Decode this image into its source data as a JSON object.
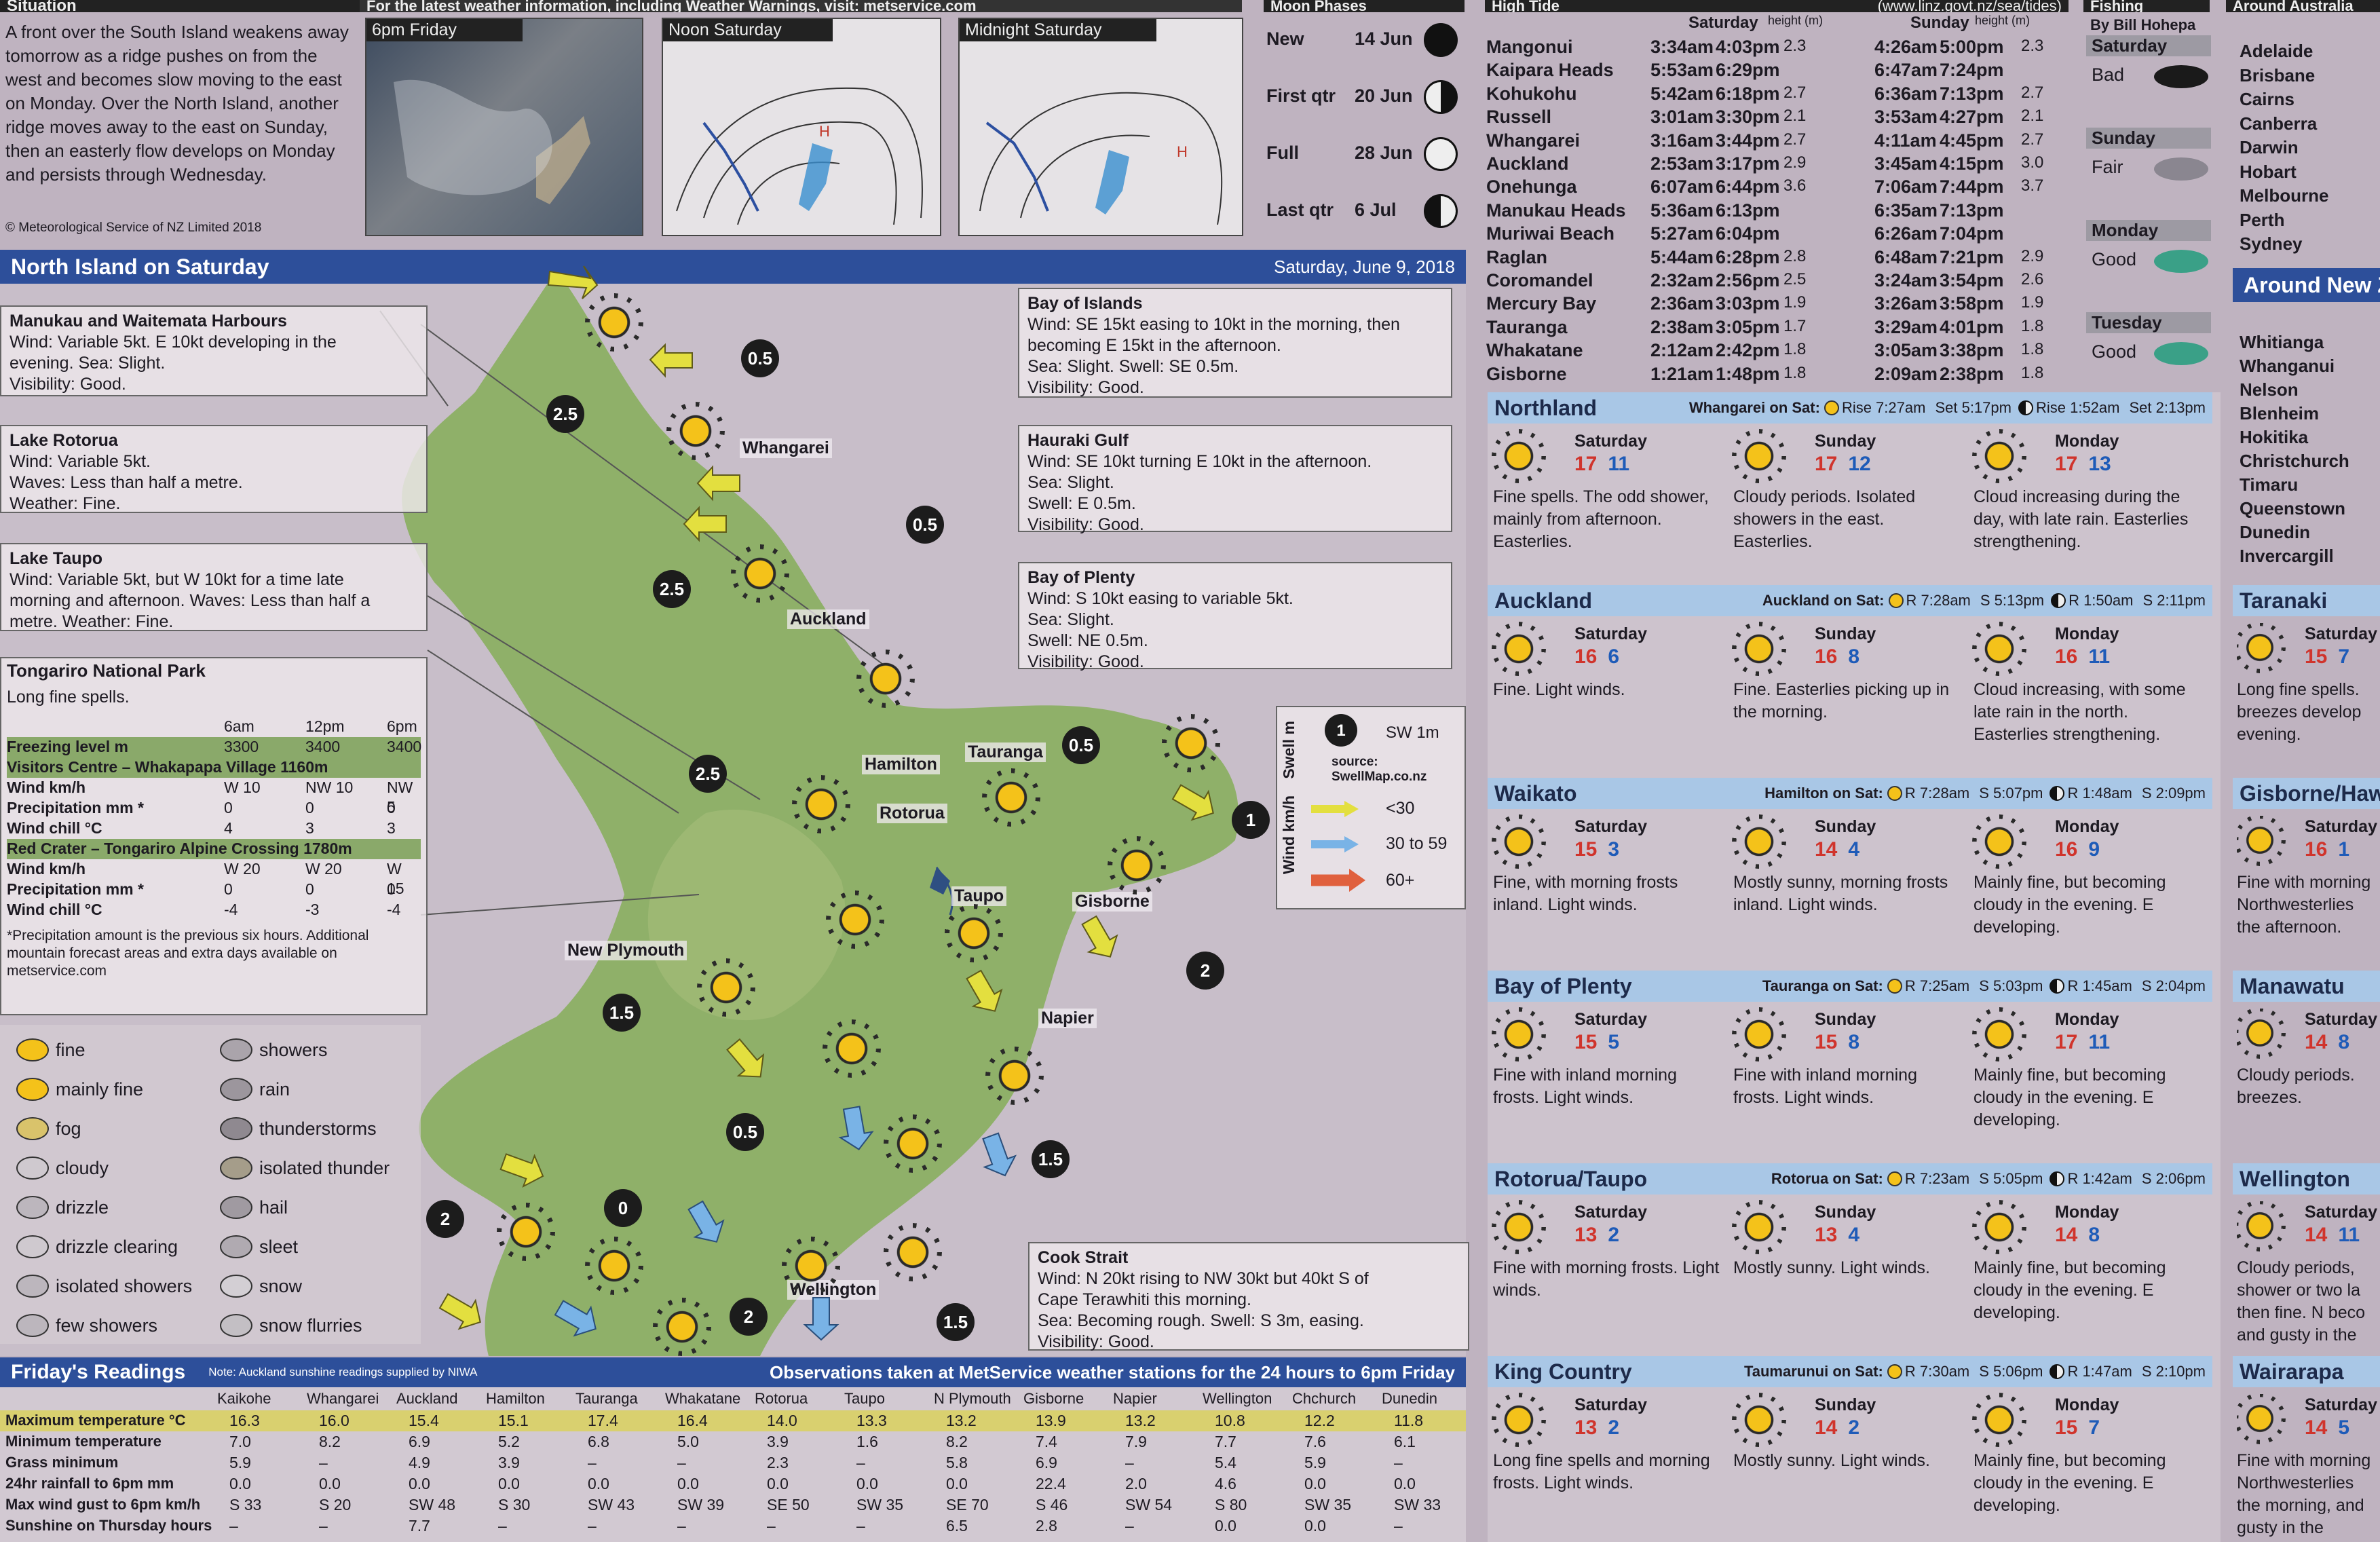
{
  "situation": {
    "title": "Situation",
    "text": "A front over the South Island weakens away tomorrow as a ridge pushes on from the west and becomes slow moving to the east on Monday. Over the North Island, another ridge moves away to the east on Sunday, then an easterly flow develops on Monday and persists through Wednesday.",
    "copyright": "© Meteorological Service of NZ Limited 2018",
    "map_titles": [
      "6pm Friday",
      "Noon Saturday",
      "Midnight Saturday"
    ],
    "top_note": "For the latest weather information, including Weather Warnings, visit: metservice.com"
  },
  "moon": {
    "title": "Moon Phases",
    "phases": [
      {
        "name": "New",
        "date": "14 Jun"
      },
      {
        "name": "First qtr",
        "date": "20 Jun"
      },
      {
        "name": "Full",
        "date": "28 Jun"
      },
      {
        "name": "Last qtr",
        "date": "6 Jul"
      }
    ]
  },
  "tides": {
    "title": "High Tide",
    "source": "(www.linz.govt.nz/sea/tides)",
    "col_sat": "Saturday",
    "col_sun": "Sunday",
    "height_label": "height (m)",
    "rows": [
      {
        "place": "Mangonui",
        "s1": "3:34am",
        "s2": "4:03pm",
        "sh": "2.3",
        "u1": "4:26am",
        "u2": "5:00pm",
        "uh": "2.3"
      },
      {
        "place": "Kaipara Heads",
        "s1": "5:53am",
        "s2": "6:29pm",
        "sh": "",
        "u1": "6:47am",
        "u2": "7:24pm",
        "uh": ""
      },
      {
        "place": "Kohukohu",
        "s1": "5:42am",
        "s2": "6:18pm",
        "sh": "2.7",
        "u1": "6:36am",
        "u2": "7:13pm",
        "uh": "2.7"
      },
      {
        "place": "Russell",
        "s1": "3:01am",
        "s2": "3:30pm",
        "sh": "2.1",
        "u1": "3:53am",
        "u2": "4:27pm",
        "uh": "2.1"
      },
      {
        "place": "Whangarei",
        "s1": "3:16am",
        "s2": "3:44pm",
        "sh": "2.7",
        "u1": "4:11am",
        "u2": "4:45pm",
        "uh": "2.7"
      },
      {
        "place": "Auckland",
        "s1": "2:53am",
        "s2": "3:17pm",
        "sh": "2.9",
        "u1": "3:45am",
        "u2": "4:15pm",
        "uh": "3.0"
      },
      {
        "place": "Onehunga",
        "s1": "6:07am",
        "s2": "6:44pm",
        "sh": "3.6",
        "u1": "7:06am",
        "u2": "7:44pm",
        "uh": "3.7"
      },
      {
        "place": "Manukau Heads",
        "s1": "5:36am",
        "s2": "6:13pm",
        "sh": "",
        "u1": "6:35am",
        "u2": "7:13pm",
        "uh": ""
      },
      {
        "place": "Muriwai Beach",
        "s1": "5:27am",
        "s2": "6:04pm",
        "sh": "",
        "u1": "6:26am",
        "u2": "7:04pm",
        "uh": ""
      },
      {
        "place": "Raglan",
        "s1": "5:44am",
        "s2": "6:28pm",
        "sh": "2.8",
        "u1": "6:48am",
        "u2": "7:21pm",
        "uh": "2.9"
      },
      {
        "place": "Coromandel",
        "s1": "2:32am",
        "s2": "2:56pm",
        "sh": "2.5",
        "u1": "3:24am",
        "u2": "3:54pm",
        "uh": "2.6"
      },
      {
        "place": "Mercury Bay",
        "s1": "2:36am",
        "s2": "3:03pm",
        "sh": "1.9",
        "u1": "3:26am",
        "u2": "3:58pm",
        "uh": "1.9"
      },
      {
        "place": "Tauranga",
        "s1": "2:38am",
        "s2": "3:05pm",
        "sh": "1.7",
        "u1": "3:29am",
        "u2": "4:01pm",
        "uh": "1.8"
      },
      {
        "place": "Whakatane",
        "s1": "2:12am",
        "s2": "2:42pm",
        "sh": "1.8",
        "u1": "3:05am",
        "u2": "3:38pm",
        "uh": "1.8"
      },
      {
        "place": "Gisborne",
        "s1": "1:21am",
        "s2": "1:48pm",
        "sh": "1.8",
        "u1": "2:09am",
        "u2": "2:38pm",
        "uh": "1.8"
      }
    ]
  },
  "fishing": {
    "title": "Fishing",
    "author": "By Bill Hohepa",
    "days": [
      {
        "day": "Saturday",
        "rating": "Bad"
      },
      {
        "day": "Sunday",
        "rating": "Fair"
      },
      {
        "day": "Monday",
        "rating": "Good"
      },
      {
        "day": "Tuesday",
        "rating": "Good"
      }
    ]
  },
  "australia": {
    "title": "Around Australia",
    "cities": [
      "Adelaide",
      "Brisbane",
      "Cairns",
      "Canberra",
      "Darwin",
      "Hobart",
      "Melbourne",
      "Perth",
      "Sydney"
    ]
  },
  "around_nz": {
    "title": "Around New Zealand",
    "cities": [
      "Whitianga",
      "Whanganui",
      "Nelson",
      "Blenheim",
      "Hokitika",
      "Christchurch",
      "Timaru",
      "Queenstown",
      "Dunedin",
      "Invercargill"
    ]
  },
  "north_island": {
    "title": "North Island on Saturday",
    "date": "Saturday, June 9, 2018",
    "marine": [
      {
        "title": "Manukau and Waitemata Harbours",
        "lines": [
          "Wind: Variable 5kt. E 10kt developing in the",
          "evening. Sea: Slight.",
          "Visibility: Good."
        ]
      },
      {
        "title": "Lake Rotorua",
        "lines": [
          "Wind: Variable 5kt.",
          "Waves: Less than half a metre.",
          "Weather: Fine."
        ]
      },
      {
        "title": "Lake Taupo",
        "lines": [
          "Wind: Variable 5kt, but W 10kt for a time late",
          "morning and afternoon. Waves: Less than half a",
          "metre. Weather: Fine."
        ]
      },
      {
        "title": "Bay of Islands",
        "lines": [
          "Wind: SE 15kt easing to 10kt in the morning, then",
          "becoming E 15kt in the afternoon.",
          "Sea: Slight. Swell: SE 0.5m.",
          "Visibility: Good."
        ]
      },
      {
        "title": "Hauraki Gulf",
        "lines": [
          "Wind: SE 10kt turning E 10kt in the afternoon.",
          "Sea: Slight.",
          "Swell: E 0.5m.",
          "Visibility: Good."
        ]
      },
      {
        "title": "Bay of Plenty",
        "lines": [
          "Wind: S 10kt easing to variable 5kt.",
          "Sea: Slight.",
          "Swell: NE 0.5m.",
          "Visibility: Good."
        ]
      },
      {
        "title": "Cook Strait",
        "lines": [
          "Wind: N 20kt rising to NW 30kt but 40kt S of",
          "Cape Terawhiti this morning.",
          "Sea: Becoming rough. Swell: S 3m, easing.",
          "Visibility: Good."
        ]
      }
    ],
    "places": [
      "Whangarei",
      "Auckland",
      "Hamilton",
      "Tauranga",
      "Rotorua",
      "Taupo",
      "Gisborne",
      "New Plymouth",
      "Napier",
      "Wellington"
    ],
    "swell_values": [
      "2.5",
      "0.5",
      "0.5",
      "2.5",
      "2.5",
      "0.5",
      "1",
      "2",
      "1.5",
      "0.5",
      "1.5",
      "2",
      "0",
      "2",
      "1.5"
    ],
    "swell_legend": {
      "swell_title": "Swell m",
      "sample_value": "1",
      "sample_dir": "SW 1m",
      "source": "source: SwellMap.co.nz",
      "wind_title": "Wind km/h",
      "bands": [
        "<30",
        "30 to 59",
        "60+"
      ]
    },
    "tongariro": {
      "title": "Tongariro National Park",
      "summary": "Long fine spells.",
      "times": [
        "6am",
        "12pm",
        "6pm"
      ],
      "rows": [
        {
          "label": "Freezing level m",
          "v": [
            "3300",
            "3400",
            "3400"
          ]
        },
        {
          "label": "Visitors Centre – Whakapapa Village 1160m",
          "v": [
            "",
            "",
            ""
          ]
        },
        {
          "label": "Wind km/h",
          "v": [
            "W 10",
            "NW 10",
            "NW 5"
          ]
        },
        {
          "label": "Precipitation mm *",
          "v": [
            "0",
            "0",
            "0"
          ]
        },
        {
          "label": "Wind chill °C",
          "v": [
            "4",
            "3",
            "3"
          ]
        },
        {
          "label": "Red Crater – Tongariro Alpine Crossing 1780m",
          "v": [
            "",
            "",
            ""
          ]
        },
        {
          "label": "Wind km/h",
          "v": [
            "W 20",
            "W 20",
            "W 15"
          ]
        },
        {
          "label": "Precipitation mm *",
          "v": [
            "0",
            "0",
            "0"
          ]
        },
        {
          "label": "Wind chill °C",
          "v": [
            "-4",
            "-3",
            "-4"
          ]
        }
      ],
      "footnote": "*Precipitation amount is the previous six hours. Additional mountain forecast areas and extra days available on metservice.com"
    },
    "legend": [
      "fine",
      "mainly fine",
      "fog",
      "cloudy",
      "drizzle",
      "drizzle clearing",
      "isolated showers",
      "few showers",
      "showers",
      "rain",
      "thunderstorms",
      "isolated thunder",
      "hail",
      "sleet",
      "snow",
      "snow flurries"
    ]
  },
  "readings": {
    "title": "Friday's Readings",
    "note": "Note: Auckland sunshine readings supplied by NIWA",
    "banner": "Observations taken at MetService weather stations for the 24 hours to 6pm Friday",
    "stations": [
      "Kaikohe",
      "Whangarei",
      "Auckland",
      "Hamilton",
      "Tauranga",
      "Whakatane",
      "Rotorua",
      "Taupo",
      "N Plymouth",
      "Gisborne",
      "Napier",
      "Wellington",
      "Chchurch",
      "Dunedin"
    ],
    "rows": [
      {
        "label": "Maximum temperature °C",
        "v": [
          "16.3",
          "16.0",
          "15.4",
          "15.1",
          "17.4",
          "16.4",
          "14.0",
          "13.3",
          "13.2",
          "13.9",
          "13.2",
          "10.8",
          "12.2",
          "11.8"
        ]
      },
      {
        "label": "Minimum temperature",
        "v": [
          "7.0",
          "8.2",
          "6.9",
          "5.2",
          "6.8",
          "5.0",
          "3.9",
          "1.6",
          "8.2",
          "7.4",
          "7.9",
          "7.7",
          "7.6",
          "6.1"
        ]
      },
      {
        "label": "Grass minimum",
        "v": [
          "5.9",
          "–",
          "4.9",
          "3.9",
          "–",
          "–",
          "2.3",
          "–",
          "5.8",
          "6.9",
          "–",
          "5.4",
          "5.9",
          "–"
        ]
      },
      {
        "label": "24hr rainfall to 6pm mm",
        "v": [
          "0.0",
          "0.0",
          "0.0",
          "0.0",
          "0.0",
          "0.0",
          "0.0",
          "0.0",
          "0.0",
          "22.4",
          "2.0",
          "4.6",
          "0.0",
          "0.0"
        ]
      },
      {
        "label": "Max wind gust to 6pm km/h",
        "v": [
          "S 33",
          "S 20",
          "SW 48",
          "S 30",
          "SW 43",
          "SW 39",
          "SE 50",
          "SW 35",
          "SE 70",
          "S 46",
          "SW 54",
          "S 80",
          "SW 35",
          "SW 33"
        ]
      },
      {
        "label": "Sunshine on Thursday hours",
        "v": [
          "–",
          "–",
          "7.7",
          "–",
          "–",
          "–",
          "–",
          "–",
          "6.5",
          "2.8",
          "–",
          "0.0",
          "0.0",
          "–"
        ]
      }
    ]
  },
  "forecasts": [
    {
      "region": "Northland",
      "sun": "Whangarei on Sat:",
      "rise": "Rise 7:27am",
      "set": "Set 5:17pm",
      "mrise": "Rise 1:52am",
      "mset": "Set 2:13pm",
      "days": [
        {
          "d": "Saturday",
          "hi": "17",
          "lo": "11",
          "t": "Fine spells. The odd shower, mainly from afternoon. Easterlies."
        },
        {
          "d": "Sunday",
          "hi": "17",
          "lo": "12",
          "t": "Cloudy periods. Isolated showers in the east. Easterlies."
        },
        {
          "d": "Monday",
          "hi": "17",
          "lo": "13",
          "t": "Cloud increasing during the day, with late rain. Easterlies strengthening."
        }
      ]
    },
    {
      "region": "Auckland",
      "sun": "Auckland on Sat:",
      "rise": "R 7:28am",
      "set": "S 5:13pm",
      "mrise": "R 1:50am",
      "mset": "S 2:11pm",
      "days": [
        {
          "d": "Saturday",
          "hi": "16",
          "lo": "6",
          "t": "Fine. Light winds."
        },
        {
          "d": "Sunday",
          "hi": "16",
          "lo": "8",
          "t": "Fine. Easterlies picking up in the morning."
        },
        {
          "d": "Monday",
          "hi": "16",
          "lo": "11",
          "t": "Cloud increasing, with some late rain in the north. Easterlies strengthening."
        }
      ]
    },
    {
      "region": "Waikato",
      "sun": "Hamilton on Sat:",
      "rise": "R 7:28am",
      "set": "S 5:07pm",
      "mrise": "R 1:48am",
      "mset": "S 2:09pm",
      "days": [
        {
          "d": "Saturday",
          "hi": "15",
          "lo": "3",
          "t": "Fine, with morning frosts inland. Light winds."
        },
        {
          "d": "Sunday",
          "hi": "14",
          "lo": "4",
          "t": "Mostly sunny, morning frosts inland. Light winds."
        },
        {
          "d": "Monday",
          "hi": "16",
          "lo": "9",
          "t": "Mainly fine, but becoming cloudy in the evening. E developing."
        }
      ]
    },
    {
      "region": "Bay of Plenty",
      "sun": "Tauranga on Sat:",
      "rise": "R 7:25am",
      "set": "S 5:03pm",
      "mrise": "R 1:45am",
      "mset": "S 2:04pm",
      "days": [
        {
          "d": "Saturday",
          "hi": "15",
          "lo": "5",
          "t": "Fine with inland morning frosts. Light winds."
        },
        {
          "d": "Sunday",
          "hi": "15",
          "lo": "8",
          "t": "Fine with inland morning frosts. Light winds."
        },
        {
          "d": "Monday",
          "hi": "17",
          "lo": "11",
          "t": "Mainly fine, but becoming cloudy in the evening. E developing."
        }
      ]
    },
    {
      "region": "Rotorua/Taupo",
      "sun": "Rotorua on Sat:",
      "rise": "R 7:23am",
      "set": "S 5:05pm",
      "mrise": "R 1:42am",
      "mset": "S 2:06pm",
      "days": [
        {
          "d": "Saturday",
          "hi": "13",
          "lo": "2",
          "t": "Fine with morning frosts. Light winds."
        },
        {
          "d": "Sunday",
          "hi": "13",
          "lo": "4",
          "t": "Mostly sunny. Light winds."
        },
        {
          "d": "Monday",
          "hi": "14",
          "lo": "8",
          "t": "Mainly fine, but becoming cloudy in the evening. E developing."
        }
      ]
    },
    {
      "region": "King Country",
      "sun": "Taumarunui on Sat:",
      "rise": "R 7:30am",
      "set": "S 5:06pm",
      "mrise": "R 1:47am",
      "mset": "S 2:10pm",
      "days": [
        {
          "d": "Saturday",
          "hi": "13",
          "lo": "2",
          "t": "Long fine spells and morning frosts. Light winds."
        },
        {
          "d": "Sunday",
          "hi": "14",
          "lo": "2",
          "t": "Mostly sunny. Light winds."
        },
        {
          "d": "Monday",
          "hi": "15",
          "lo": "7",
          "t": "Mainly fine, but becoming cloudy in the evening. E developing."
        }
      ]
    }
  ],
  "right_regions": [
    {
      "region": "Taranaki",
      "d": "Saturday",
      "hi": "15",
      "lo": "7",
      "t": "Long fine spells. breezes develop evening."
    },
    {
      "region": "Gisborne/Hawke's Bay",
      "d": "Saturday",
      "hi": "16",
      "lo": "1",
      "t": "Fine with morning Northwesterlies the afternoon."
    },
    {
      "region": "Manawatu",
      "d": "Saturday",
      "hi": "14",
      "lo": "8",
      "t": "Cloudy periods. breezes."
    },
    {
      "region": "Wellington",
      "d": "Saturday",
      "hi": "14",
      "lo": "11",
      "t": "Cloudy periods, shower or two la then fine. N beco and gusty in the"
    },
    {
      "region": "Wairarapa",
      "d": "Saturday",
      "hi": "14",
      "lo": "5",
      "t": "Fine with morning Northwesterlies the morning, and gusty in the"
    }
  ]
}
